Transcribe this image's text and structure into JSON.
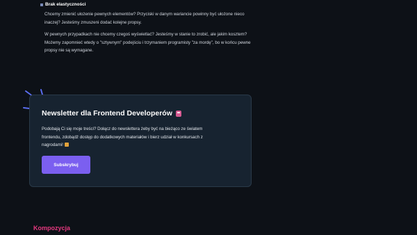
{
  "article": {
    "bullet_title": "Brak elastyczności",
    "paragraph1": "Chcemy zmienić ułożenie pewnych elementów? Przyciski w danym wariancie powinny być ułożone nieco inaczej? Jesteśmy zmuszeni dodać kolejne propsy.",
    "paragraph2": "W pewnych przypadkach nie chcemy czegoś wyświetlać? Jesteśmy w stanie to zrobić, ale jakim kosztem? Możemy zapomnieć wtedy o \"sztywnym\" podejściu i trzymaniem programisty \"za mordę\", bo w końcu pewne propsy nie są wymagane.",
    "next_heading": "Kompozycja"
  },
  "newsletter": {
    "title": "Newsletter dla Frontend Developerów",
    "title_icon": "envelope-icon",
    "text": "Podobają Ci się moje treści? Dołącz do newslettera żeby być na bieżąco ze światem frontendu, zdobądź dostęp do dodatkowych materiałów i bierz udział w konkursach z nagrodami!",
    "text_icon": "gift-icon",
    "button_label": "Subskrybuj"
  },
  "colors": {
    "background": "#0d1117",
    "card": "#172330",
    "accent_button": "#7b5ff0",
    "heading_pink": "#e5387f",
    "burst_lines": "#5b6ef0"
  }
}
